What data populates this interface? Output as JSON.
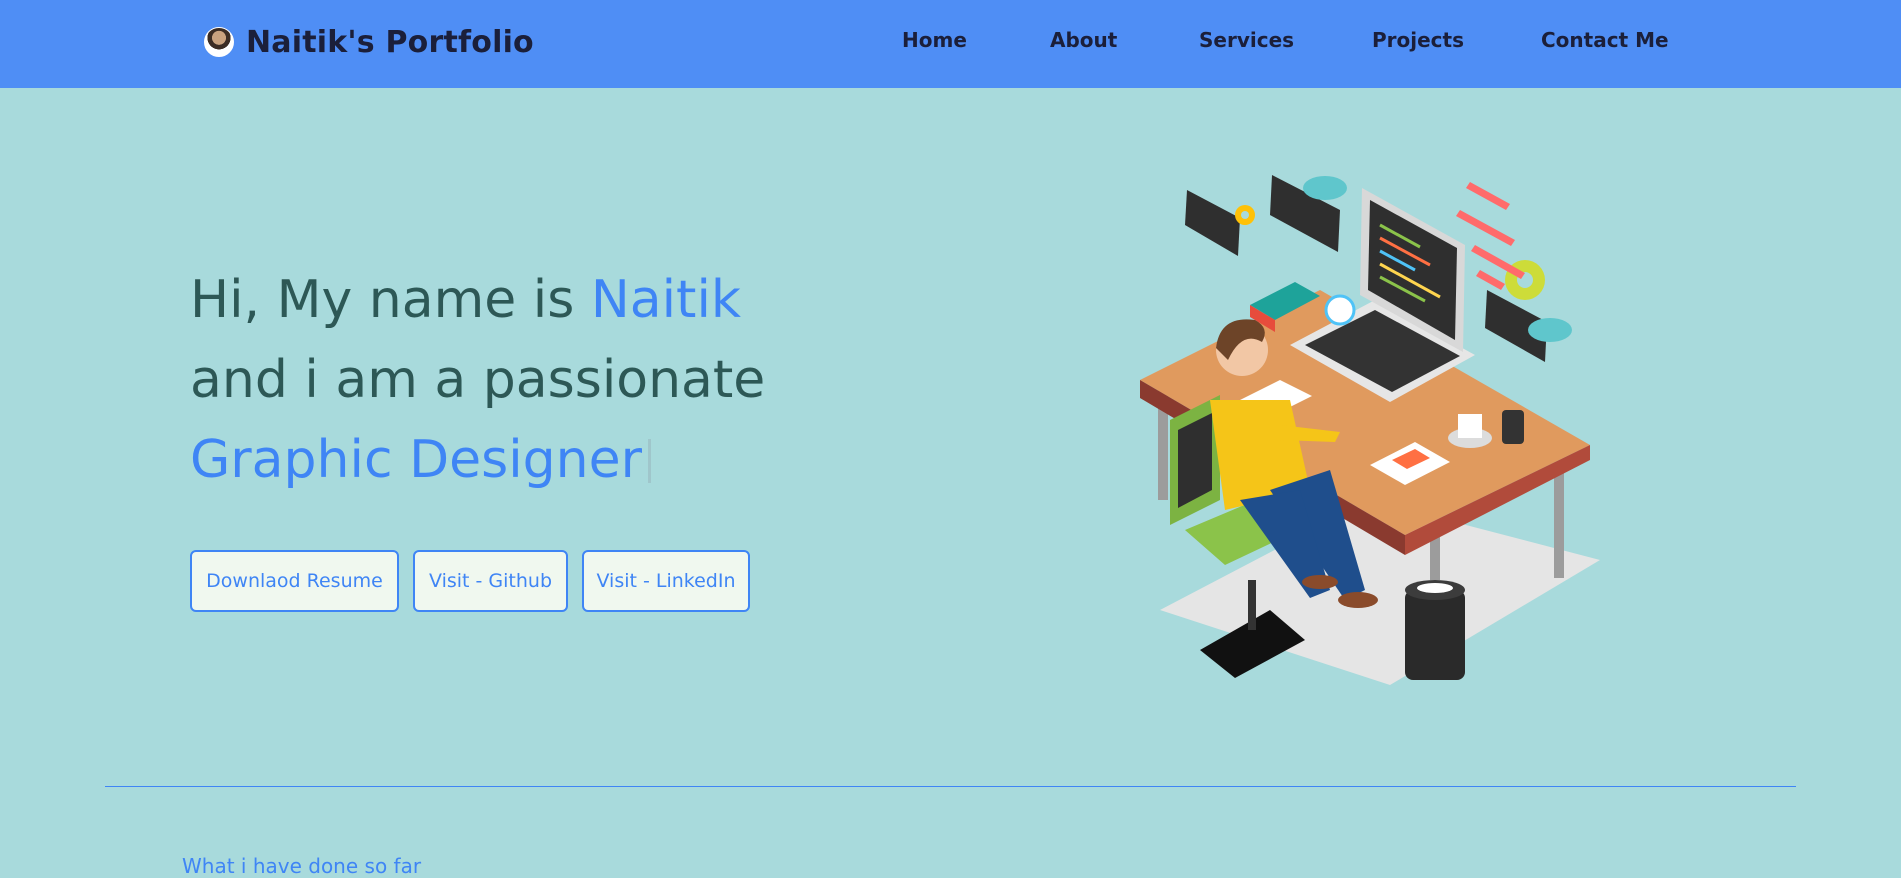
{
  "navbar": {
    "brand": "Naitik's Portfolio",
    "links": [
      "Home",
      "About",
      "Services",
      "Projects",
      "Contact Me"
    ]
  },
  "hero": {
    "line1_prefix": "Hi, My name is",
    "line1_name": "Naitik",
    "line2": "and i am a passionate",
    "line3_role": "Graphic Designer",
    "buttons": [
      "Downlaod Resume",
      "Visit - Github",
      "Visit - LinkedIn"
    ]
  },
  "section": {
    "subtitle": "What i have done so far"
  },
  "colors": {
    "navbar_bg": "#4f8ef5",
    "page_bg": "#a8dadc",
    "accent": "#3f85f5",
    "heading_text": "#2d5856",
    "button_bg": "#f0f8ef"
  },
  "icons": {
    "avatar": "profile-photo",
    "illustration": "developer-at-desk-isometric"
  }
}
